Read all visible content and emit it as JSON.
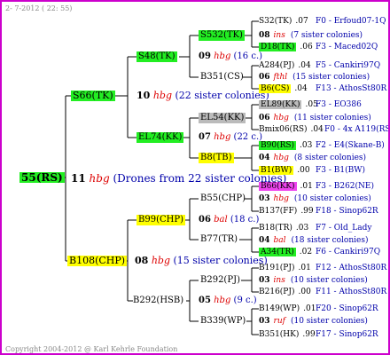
{
  "header": "2-  7-2012 ( 22: 55)",
  "copyright": "Copyright 2004-2012 @ Karl Kehrle Foundation",
  "nodes": {
    "root": "55(RS)",
    "root_year": "11",
    "root_mark": "hbg",
    "root_note": "(Drones from 22 sister colonies)",
    "s66": "S66(TK)",
    "s66_year": "10",
    "s66_mark": "hbg",
    "s66_note": "(22 sister colonies)",
    "b108": "B108(CHP)",
    "b108_year": "08",
    "b108_mark": "hbg",
    "b108_note": "(15 sister colonies)",
    "s48": "S48(TK)",
    "s48_year": "09",
    "s48_mark": "hbg",
    "s48_note": "(16 c.)",
    "el74": "EL74(KK)",
    "el74_year": "07",
    "el74_mark": "hbg",
    "el74_note": "(22 c.)",
    "b99": "B99(CHP)",
    "b99_year": "06",
    "b99_mark": "bal",
    "b99_note": "(18 c.)",
    "b292hsb": "B292(HSB)",
    "b292hsb_year": "05",
    "b292hsb_mark": "hbg",
    "b292hsb_note": "(9 c.)",
    "s532": "S532(TK)",
    "b351": "B351(CS)",
    "el54": "EL54(KK)",
    "b8": "B8(TB)",
    "b55": "B55(CHP)",
    "b77": "B77(TR)",
    "b292pj": "B292(PJ)",
    "b339": "B339(WP)"
  },
  "right_rows": [
    {
      "a": "S32(TK)",
      "b": ".07",
      "c": "F0 - Erfoud07-1Q",
      "hl": ""
    },
    {
      "a": "08",
      "b": "ins",
      "c": "(7 sister colonies)",
      "hl": "",
      "kind": "mid"
    },
    {
      "a": "D18(TK)",
      "b": ".06",
      "c": "F3 - Maced02Q",
      "hl": "g"
    },
    {
      "a": "A284(PJ)",
      "b": ".04",
      "c": "F5 - Cankiri97Q",
      "hl": ""
    },
    {
      "a": "06",
      "b": "fthl",
      "c": "(15 sister colonies)",
      "hl": "",
      "kind": "mid"
    },
    {
      "a": "B6(CS)",
      "b": ".04",
      "c": "F13 - AthosSt80R",
      "hl": "y"
    },
    {
      "a": "EL89(KK)",
      "b": ".05",
      "c": "F3 - EO386",
      "hl": "s"
    },
    {
      "a": "06",
      "b": "hbg",
      "c": "(11 sister colonies)",
      "hl": "",
      "kind": "mid"
    },
    {
      "a": "Bmix06(RS)",
      "b": ".04",
      "c": "F0 - 4x A119(RS)",
      "hl": ""
    },
    {
      "a": "B90(RS)",
      "b": ".03",
      "c": "F2 - E4(Skane-B)",
      "hl": "g"
    },
    {
      "a": "04",
      "b": "hbg",
      "c": "(8 sister colonies)",
      "hl": "",
      "kind": "mid"
    },
    {
      "a": "B1(BW)",
      "b": ".00",
      "c": "F3 - B1(BW)",
      "hl": "y"
    },
    {
      "a": "B66(KK)",
      "b": ".01",
      "c": "F3 - B262(NE)",
      "hl": "m"
    },
    {
      "a": "03",
      "b": "hbg",
      "c": "(10 sister colonies)",
      "hl": "",
      "kind": "mid"
    },
    {
      "a": "B137(FF)",
      "b": ".99",
      "c": "F18 - Sinop62R",
      "hl": ""
    },
    {
      "a": "B18(TR)",
      "b": ".03",
      "c": "F7 - Old_Lady",
      "hl": ""
    },
    {
      "a": "04",
      "b": "bal",
      "c": "(18 sister colonies)",
      "hl": "",
      "kind": "mid"
    },
    {
      "a": "A34(TR)",
      "b": ".02",
      "c": "F6 - Cankiri97Q",
      "hl": "g"
    },
    {
      "a": "B191(PJ)",
      "b": ".01",
      "c": "F12 - AthosSt80R",
      "hl": ""
    },
    {
      "a": "03",
      "b": "ins",
      "c": "(10 sister colonies)",
      "hl": "",
      "kind": "mid"
    },
    {
      "a": "B216(PJ)",
      "b": ".00",
      "c": "F11 - AthosSt80R",
      "hl": ""
    },
    {
      "a": "B149(WP)",
      "b": ".01",
      "c": "F20 - Sinop62R",
      "hl": ""
    },
    {
      "a": "03",
      "b": "ruf",
      "c": "(10 sister colonies)",
      "hl": "",
      "kind": "mid"
    },
    {
      "a": "B351(HK)",
      "b": ".99",
      "c": "F17 - Sinop62R",
      "hl": ""
    }
  ]
}
